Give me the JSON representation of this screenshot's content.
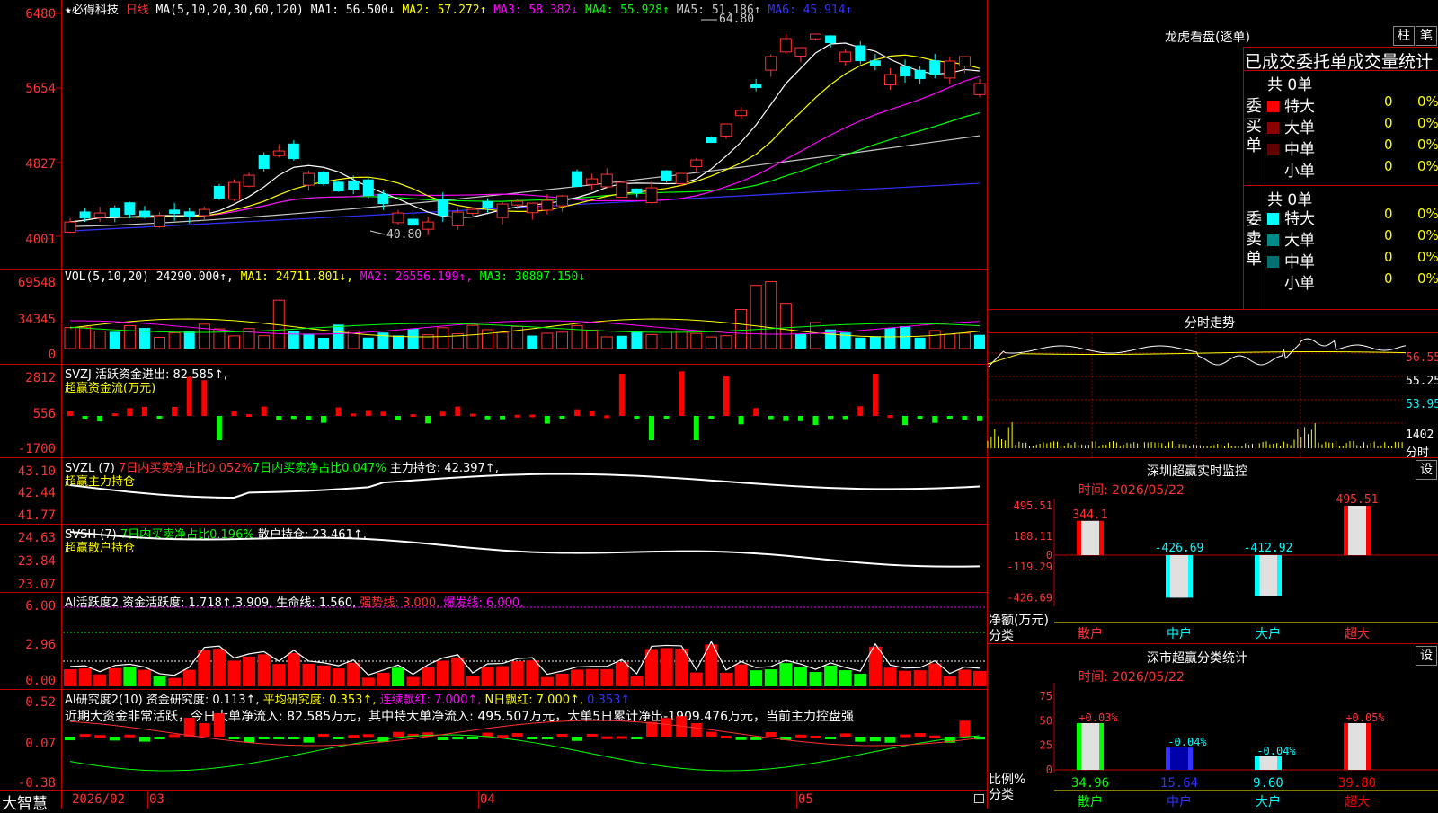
{
  "stock": {
    "star": "★",
    "name": "必得科技",
    "period": "日线"
  },
  "ma_header": {
    "label": "MA(5,10,20,30,60,120)",
    "items": [
      {
        "text": "MA1: 56.500↓",
        "color": "#ffffff"
      },
      {
        "text": "MA2: 57.272↑",
        "color": "#ffff00"
      },
      {
        "text": "MA3: 58.382↓",
        "color": "#ff00ff"
      },
      {
        "text": "MA4: 55.928↑",
        "color": "#00ff00"
      },
      {
        "text": "MA5: 51.186↑",
        "color": "#c8c8c8"
      },
      {
        "text": "MA6: 45.914↑",
        "color": "#3333ff"
      }
    ]
  },
  "price_axis": [
    "6480",
    "5654",
    "4827",
    "4001"
  ],
  "price_annotations": {
    "high": "64.80",
    "low": "40.80"
  },
  "vol_header": {
    "label": "VOL(5,10,20)",
    "value": "24290.000↑,",
    "items": [
      {
        "text": "MA1: 24711.801↓,",
        "color": "#ffff00"
      },
      {
        "text": "MA2: 26556.199↑,",
        "color": "#ff00ff"
      },
      {
        "text": "MA3: 30807.150↓",
        "color": "#00ff00"
      }
    ]
  },
  "vol_axis": [
    "69548",
    "34345",
    "0"
  ],
  "svzj": {
    "line1": "SVZJ  活跃资金进出: 82.585↑,",
    "line2": "超赢资金流(万元)",
    "axis": [
      "2812",
      "556",
      "-1700"
    ]
  },
  "svzl": {
    "prefix": "SVZL (7) ",
    "red": "7日内买卖净占比0.052%",
    "green": "7日内买卖净占比0.047%",
    "white": "主力持仓: 42.397↑,",
    "line2": "超赢主力持仓",
    "axis": [
      "43.10",
      "42.44",
      "41.77"
    ]
  },
  "svsh": {
    "prefix": "SVSH (7) ",
    "green": "7日内买卖净占比0.196%",
    "white": "散户持仓: 23.461↑,",
    "line2": "超赢散户持仓",
    "axis": [
      "24.63",
      "23.84",
      "23.07"
    ]
  },
  "ai_active": {
    "prefix": "AI活跃度2 资金活跃度: 1.718↑,",
    "v2": "3.909,",
    "life": "生命线: 1.560,",
    "strong": "强势线: 3.000,",
    "burst": "爆发线: 6.000,",
    "axis": [
      "6.00",
      "2.96",
      "0.00"
    ]
  },
  "ai_research": {
    "prefix": "AI研究度2(10) 资金研究度: 0.113↑,",
    "avg": "平均研究度: 0.353↑,",
    "streak": "连续飘红: 7.000↑,",
    "nday": "N日飘红: 7.000↑,",
    "last": "0.353↑",
    "note": "近期大资金非常活跃，今日大单净流入: 82.585万元，其中特大单净流入: 495.507万元，大单5日累计净出-1909.476万元，当前主力控盘强",
    "axis": [
      "0.52",
      "0.07",
      "-0.38"
    ]
  },
  "date_axis": {
    "brand": "大智慧",
    "labels": [
      "2026/02",
      "03",
      "04",
      "05"
    ]
  },
  "right_panel": {
    "title": "龙虎看盘(逐单)",
    "btn1": "柱",
    "btn2": "笔",
    "tabs": "已成交委托单成交量统计",
    "buy_label": [
      "委",
      "买",
      "单"
    ],
    "sell_label": [
      "委",
      "卖",
      "单"
    ],
    "buy_total": "共 0单",
    "sell_total": "共 0单",
    "buy_rows": [
      {
        "name": "特大",
        "count": "0",
        "pct": "0%",
        "color": "#ff0000"
      },
      {
        "name": "大单",
        "count": "0",
        "pct": "0%",
        "color": "#8b0000"
      },
      {
        "name": "中单",
        "count": "0",
        "pct": "0%",
        "color": "#600000"
      },
      {
        "name": "小单",
        "count": "0",
        "pct": "0%",
        "color": "#000000"
      }
    ],
    "sell_rows": [
      {
        "name": "特大",
        "count": "0",
        "pct": "0%",
        "color": "#00ffff"
      },
      {
        "name": "大单",
        "count": "0",
        "pct": "0%",
        "color": "#008b8b"
      },
      {
        "name": "中单",
        "count": "0",
        "pct": "0%",
        "color": "#007070"
      },
      {
        "name": "小单",
        "count": "0",
        "pct": "0%",
        "color": "#000000"
      }
    ],
    "intraday": {
      "title": "分时走势",
      "axis": [
        "56.55",
        "55.25",
        "53.95"
      ],
      "vol": "1402",
      "vol_unit": "分时"
    },
    "monitor": {
      "title": "深圳超赢实时监控",
      "btn": "设",
      "time": "时间: 2026/05/22",
      "axis": [
        "495.51",
        "188.11",
        "0",
        "-119.29",
        "-426.69"
      ],
      "unit": "净额(万元)",
      "cat_label": "分类",
      "categories": [
        "散户",
        "中户",
        "大户",
        "超大"
      ],
      "values": [
        344.1,
        -426.69,
        -412.92,
        495.51
      ],
      "value_labels": [
        "344.1",
        "-426.69",
        "-412.92",
        "495.51"
      ]
    },
    "classify": {
      "title": "深市超赢分类统计",
      "btn": "设",
      "time": "时间: 2026/05/22",
      "axis": [
        "75",
        "50",
        "25",
        "0"
      ],
      "unit": "比例%",
      "cat_label": "分类",
      "categories": [
        "散户",
        "中户",
        "大户",
        "超大"
      ],
      "values": [
        34.96,
        15.64,
        9.6,
        39.8
      ],
      "value_labels": [
        "34.96",
        "15.64",
        "9.60",
        "39.80"
      ],
      "change_labels": [
        "+0.03%",
        "-0.04%",
        "-0.04%",
        "+0.05%"
      ],
      "colors": [
        "#00ff00",
        "#3333ff",
        "#00ffff",
        "#ff0000"
      ]
    }
  }
}
